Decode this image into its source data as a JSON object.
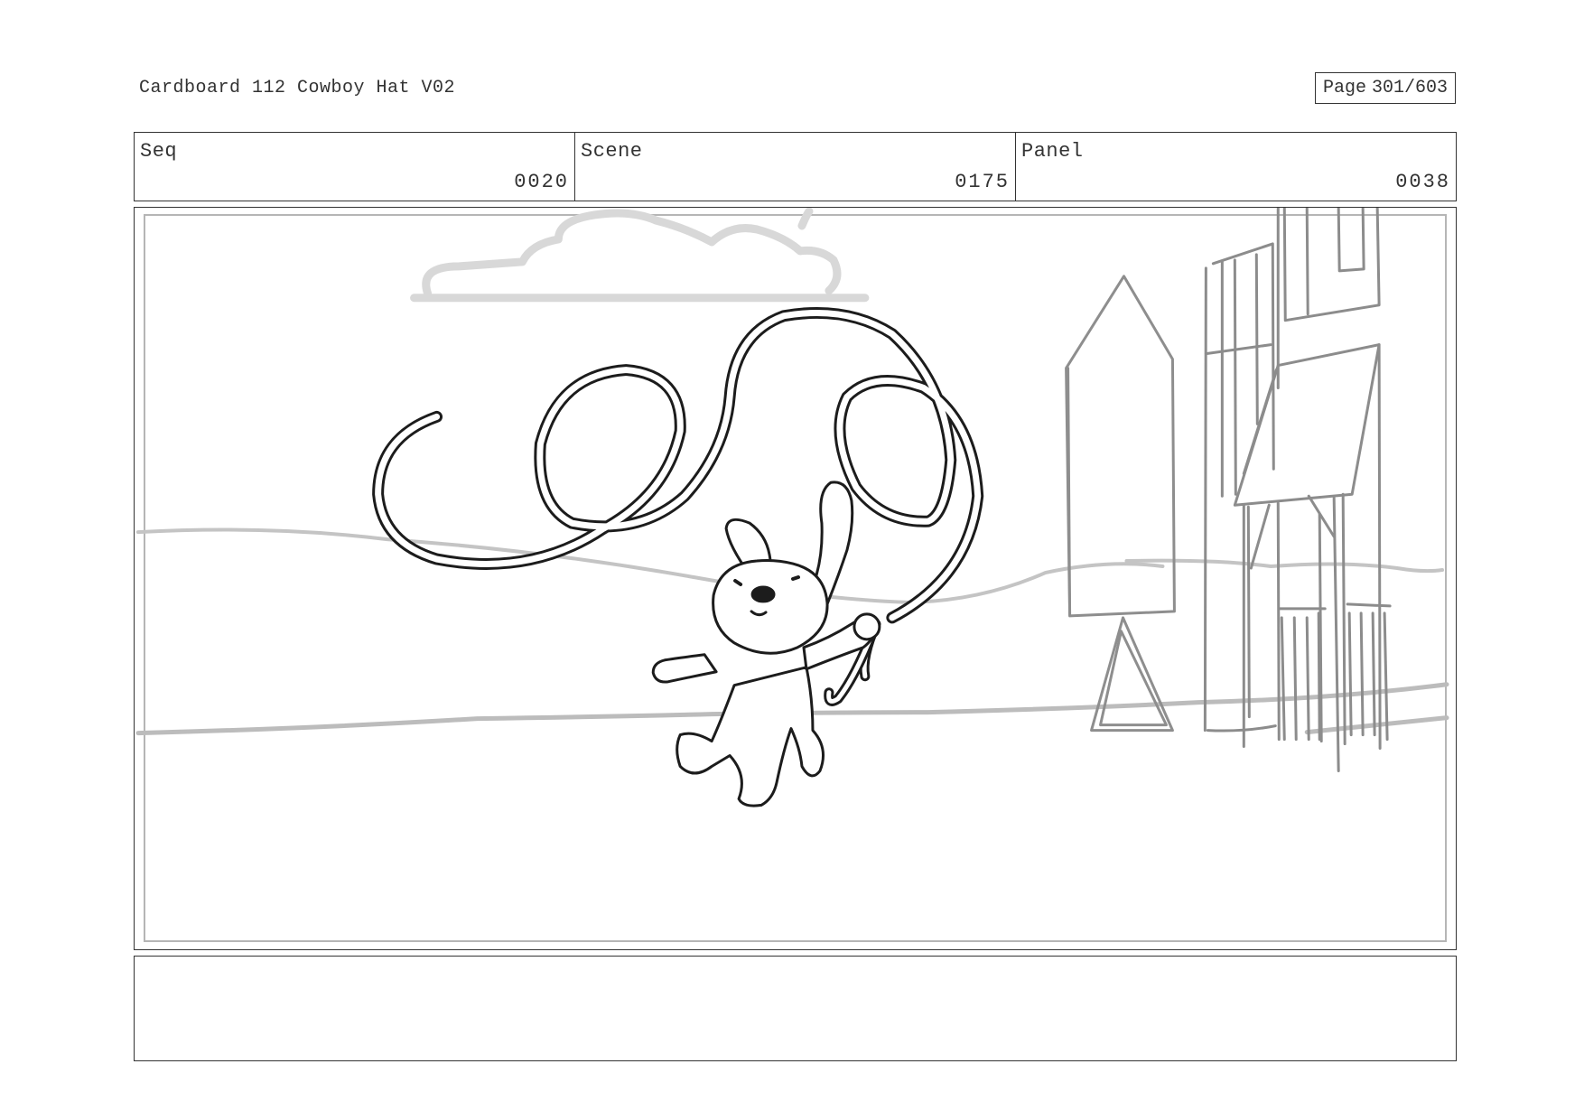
{
  "header": {
    "title": "Cardboard 112 Cowboy Hat V02",
    "page_word": "Page",
    "page_number": "301/603"
  },
  "info": {
    "seq_label": "Seq",
    "seq_value": "0020",
    "scene_label": "Scene",
    "scene_value": "0175",
    "panel_label": "Panel",
    "panel_value": "0038"
  },
  "notes": {
    "text": ""
  }
}
